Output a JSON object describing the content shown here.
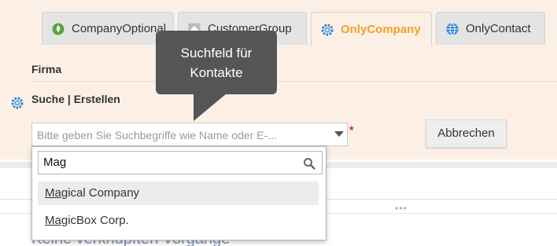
{
  "tabs": [
    {
      "label": "CompanyOptional",
      "icon": "leaf-circle-icon",
      "active": false
    },
    {
      "label": "CustomerGroup",
      "icon": "house-icon",
      "active": false
    },
    {
      "label": "OnlyCompany",
      "icon": "gear-icon",
      "active": true
    },
    {
      "label": "OnlyContact",
      "icon": "globe-icon",
      "active": false
    }
  ],
  "form": {
    "section_label": "Firma",
    "field_label": "Suche | Erstellen",
    "combo_placeholder": "Bitte geben Sie Suchbegriffe wie Name oder E-...",
    "required_marker": "*",
    "cancel_label": "Abbrechen"
  },
  "dropdown": {
    "search_value": "Mag",
    "items": [
      {
        "match": "Mag",
        "rest": "ical Company",
        "highlighted": true
      },
      {
        "match": "Mag",
        "rest": "icBox Corp.",
        "highlighted": false
      }
    ]
  },
  "tooltip": {
    "line1": "Suchfeld für",
    "line2": "Kontakte"
  },
  "lower": {
    "handle": "•••",
    "heading": "Keine verknüpften Vorgänge"
  },
  "colors": {
    "active_tab_text": "#f2a12a",
    "panel_bg": "#fcf0e6",
    "tooltip_bg": "#555555",
    "required": "#dd2222"
  }
}
